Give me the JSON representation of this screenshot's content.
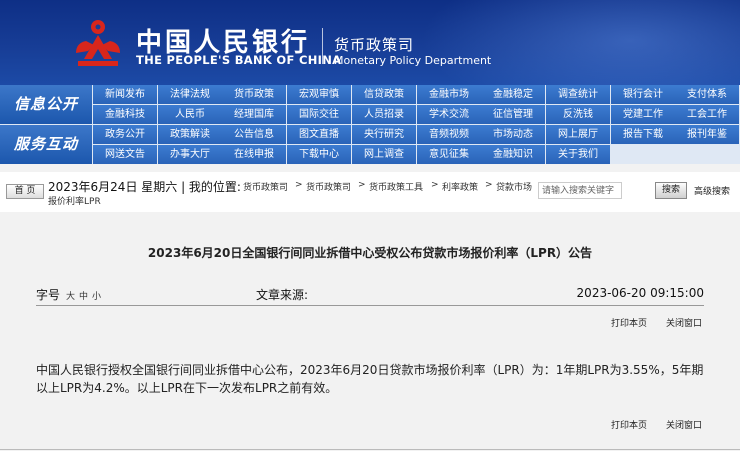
{
  "header": {
    "bank_name_cn": "中国人民银行",
    "bank_name_en": "THE PEOPLE'S BANK OF CHINA",
    "dept_cn": "货币政策司",
    "dept_en": "Monetary Policy Department"
  },
  "nav": {
    "row1_label": "信息公开",
    "row2_label": "服务互动",
    "row1_items_a": [
      "新闻发布",
      "法律法规",
      "货币政策",
      "宏观审慎",
      "信贷政策",
      "金融市场",
      "金融稳定",
      "调查统计",
      "银行会计",
      "支付体系"
    ],
    "row1_items_b": [
      "金融科技",
      "人民币",
      "经理国库",
      "国际交往",
      "人员招录",
      "学术交流",
      "征信管理",
      "反洗钱",
      "党建工作",
      "工会工作"
    ],
    "row2_items_a": [
      "政务公开",
      "政策解读",
      "公告信息",
      "图文直播",
      "央行研究",
      "音频视频",
      "市场动态",
      "网上展厅",
      "报告下载",
      "报刊年鉴"
    ],
    "row2_items_b": [
      "网送文告",
      "办事大厅",
      "在线申报",
      "下载中心",
      "网上调查",
      "意见征集",
      "金融知识",
      "关于我们"
    ]
  },
  "crumb": {
    "home_label": "首 页",
    "date": "2023年6月24日 星期六 | 我的位置:",
    "items": [
      "货币政策司",
      "货币政策司",
      "货币政策工具",
      "利率政策",
      "贷款市场"
    ],
    "sep": ">",
    "last_line": "报价利率LPR",
    "search_placeholder": "请输入搜索关键字",
    "search_button": "搜索",
    "advanced_search": "高级搜索"
  },
  "article": {
    "title": "2023年6月20日全国银行间同业拆借中心受权公布贷款市场报价利率（LPR）公告",
    "font_label": "字号",
    "font_sizes": [
      "大",
      "中",
      "小"
    ],
    "source_label": "文章来源:",
    "publish_time": "2023-06-20 09:15:00",
    "print_label": "打印本页",
    "close_label": "关闭窗口",
    "body": "中国人民银行授权全国银行间同业拆借中心公布，2023年6月20日贷款市场报价利率（LPR）为：1年期LPR为3.55%，5年期以上LPR为4.2%。以上LPR在下一次发布LPR之前有效。"
  },
  "colors": {
    "banner": "#173d96",
    "nav_cell": "#2f6cc2",
    "nav_label": "#1c57ad",
    "page_bg": "#f2f2f2",
    "logo_red": "#d8261c"
  },
  "icons": {
    "logo": "pboc-emblem-icon"
  }
}
